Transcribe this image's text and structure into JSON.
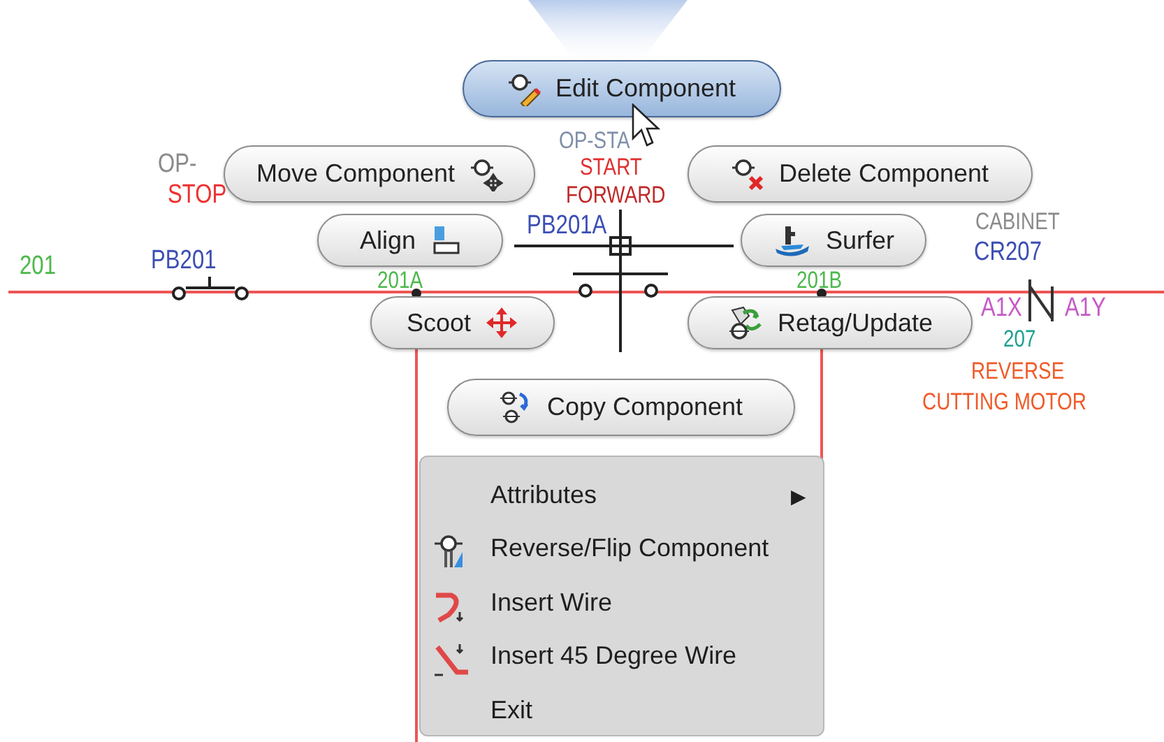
{
  "schematic": {
    "labels": [
      {
        "text": "OP-",
        "color": "#8a8a8a"
      },
      {
        "text": "STOP",
        "color": "#ee3030"
      },
      {
        "text": "201",
        "color": "#4cb84c"
      },
      {
        "text": "PB201",
        "color": "#3c4eb4"
      },
      {
        "text": "201A",
        "color": "#4cb84c"
      },
      {
        "text": "OP-STA",
        "color": "#7f8fa8"
      },
      {
        "text": "START",
        "color": "#e03030"
      },
      {
        "text": "FORWARD",
        "color": "#c02828"
      },
      {
        "text": "PB201A",
        "color": "#3c4eb4"
      },
      {
        "text": "201B",
        "color": "#4cb84c"
      },
      {
        "text": "CABINET",
        "color": "#8a8a8a"
      },
      {
        "text": "CR207",
        "color": "#3c4eb4"
      },
      {
        "text": "A1X",
        "color": "#c65ac6"
      },
      {
        "text": "A1Y",
        "color": "#c65ac6"
      },
      {
        "text": "207",
        "color": "#20a090"
      },
      {
        "text": "REVERSE",
        "color": "#f05a28"
      },
      {
        "text": "CUTTING MOTOR",
        "color": "#f05a28"
      }
    ]
  },
  "marking_menu": {
    "buttons": [
      {
        "label": "Edit Component",
        "selected": true
      },
      {
        "label": "Move Component",
        "selected": false
      },
      {
        "label": "Delete Component",
        "selected": false
      },
      {
        "label": "Align",
        "selected": false
      },
      {
        "label": "Surfer",
        "selected": false
      },
      {
        "label": "Scoot",
        "selected": false
      },
      {
        "label": "Retag/Update",
        "selected": false
      },
      {
        "label": "Copy Component",
        "selected": false
      }
    ]
  },
  "context_menu": {
    "items": [
      {
        "label": "Attributes",
        "submenu": true
      },
      {
        "label": "Reverse/Flip Component",
        "submenu": false
      },
      {
        "label": "Insert Wire",
        "submenu": false
      },
      {
        "label": "Insert 45 Degree Wire",
        "submenu": false
      },
      {
        "label": "Exit",
        "submenu": false
      }
    ],
    "submenu_arrow": "▶"
  }
}
